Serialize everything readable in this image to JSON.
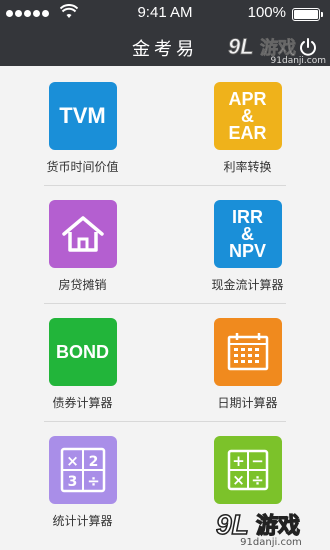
{
  "status": {
    "time": "9:41 AM",
    "battery": "100%"
  },
  "header": {
    "title": "金考易"
  },
  "items": [
    {
      "label": "货币时间价值",
      "tile_text": "TVM",
      "color": "#1a8fd8"
    },
    {
      "label": "利率转换",
      "tile_text": "APR\n&\nEAR",
      "color": "#efb21b"
    },
    {
      "label": "房贷摊销",
      "tile_text": "",
      "icon": "house-icon",
      "color": "#b45fd0"
    },
    {
      "label": "现金流计算器",
      "tile_text": "IRR\n&\nNPV",
      "color": "#1a8fd8"
    },
    {
      "label": "债券计算器",
      "tile_text": "BOND",
      "color": "#22b53a"
    },
    {
      "label": "日期计算器",
      "tile_text": "",
      "icon": "calendar-icon",
      "color": "#f08a1e"
    },
    {
      "label": "统计计算器",
      "tile_text": "",
      "icon": "math-symbols-icon",
      "color": "#a98ee8"
    },
    {
      "label": "",
      "tile_text": "",
      "icon": "calculator-icon",
      "color": "#7cc22a"
    }
  ],
  "watermark": {
    "top": "91danji.com",
    "bottom": "91danji.com",
    "brand": "9L游戏"
  }
}
